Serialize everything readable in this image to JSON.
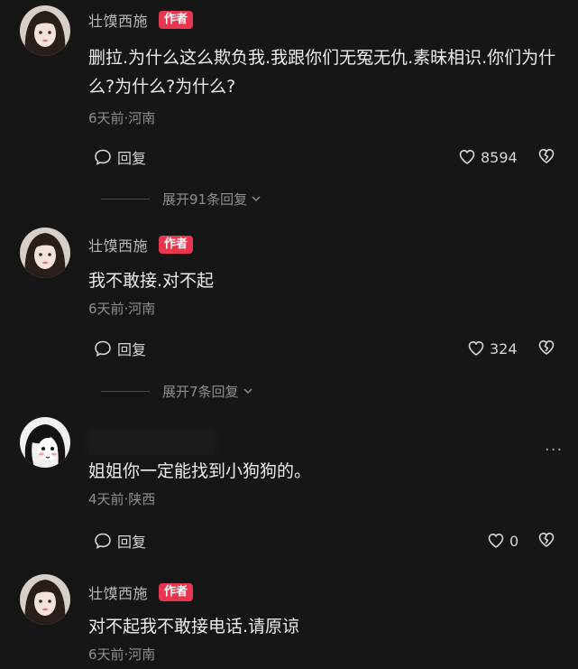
{
  "comments": [
    {
      "username": "壮馍西施",
      "badge": "作者",
      "text": "删拉.为什么这么欺负我.我跟你们无冤无仇.素昧相识.你们为什么?为什么?为什么?",
      "meta": "6天前·河南",
      "reply_label": "回复",
      "likes": "8594",
      "expand_label": "展开91条回复"
    },
    {
      "username": "壮馍西施",
      "badge": "作者",
      "text": "我不敢接.对不起",
      "meta": "6天前·河南",
      "reply_label": "回复",
      "likes": "324",
      "expand_label": "展开7条回复"
    },
    {
      "text": "姐姐你一定能找到小狗狗的。",
      "meta": "4天前·陕西",
      "reply_label": "回复",
      "likes": "0",
      "more_label": "···"
    },
    {
      "username": "壮馍西施",
      "badge": "作者",
      "text": "对不起我不敢接电话.请原谅",
      "meta": "6天前·河南"
    }
  ],
  "icons": {
    "reply": "comment-bubble-icon",
    "like": "heart-outline-icon",
    "dislike": "broken-heart-icon",
    "expand": "chevron-down-icon",
    "more": "more-dots-icon"
  },
  "colors": {
    "background": "#161616",
    "author_badge": "#e8364f",
    "meta_text": "#8e8e8e"
  }
}
